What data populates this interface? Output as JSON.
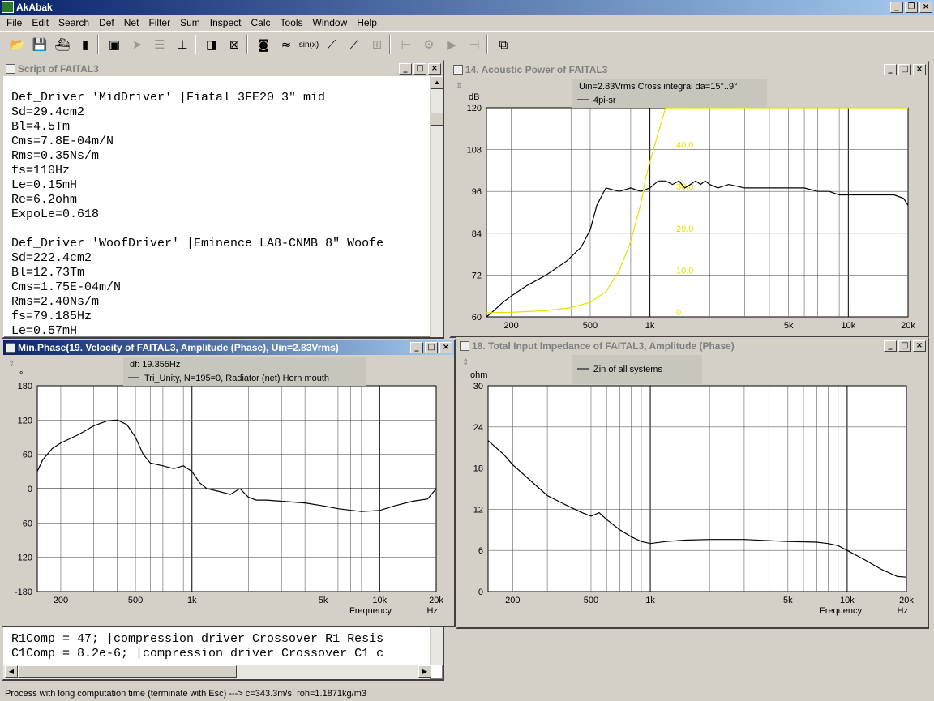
{
  "app": {
    "title": "AkAbak"
  },
  "menu": [
    "File",
    "Edit",
    "Search",
    "Def",
    "Net",
    "Filter",
    "Sum",
    "Inspect",
    "Calc",
    "Tools",
    "Window",
    "Help"
  ],
  "toolbar": {
    "buttons": [
      {
        "name": "open-folder-icon",
        "glyph": "📂"
      },
      {
        "name": "save-disk-icon",
        "glyph": "💾"
      },
      {
        "name": "ship-icon",
        "glyph": "⛴"
      },
      {
        "name": "bar-chart-icon",
        "glyph": "▮"
      },
      {
        "name": "copy-document-icon",
        "glyph": "▣"
      },
      {
        "name": "pointer-icon",
        "glyph": "➤"
      },
      {
        "name": "list-icon",
        "glyph": "☰"
      },
      {
        "name": "graph-axes-icon",
        "glyph": "⊥"
      },
      {
        "name": "speaker-icon",
        "glyph": "◨"
      },
      {
        "name": "speaker-cross-icon",
        "glyph": "⊠"
      },
      {
        "name": "loudspeaker-box-icon",
        "glyph": "◙"
      },
      {
        "name": "filter-icon",
        "glyph": "≈"
      },
      {
        "name": "sin-function-icon",
        "glyph": "sin(x)"
      },
      {
        "name": "curve-cursor-icon",
        "glyph": "⟋"
      },
      {
        "name": "curve-cursor-green-icon",
        "glyph": "⟋"
      },
      {
        "name": "curve-grid-icon",
        "glyph": "⊞"
      },
      {
        "name": "split-icon",
        "glyph": "⊢"
      },
      {
        "name": "gear-icon",
        "glyph": "⚙"
      },
      {
        "name": "play-icon",
        "glyph": "▶"
      },
      {
        "name": "lines-icon",
        "glyph": "⊣"
      },
      {
        "name": "chart-tile-icon",
        "glyph": "⧉"
      }
    ]
  },
  "script_window": {
    "title": "Script of FAITAL3",
    "lines": [
      "Def_Driver 'MidDriver' |Fiatal 3FE20 3\" mid",
      "Sd=29.4cm2",
      "Bl=4.5Tm",
      "Cms=7.8E-04m/N",
      "Rms=0.35Ns/m",
      "fs=110Hz",
      "Le=0.15mH",
      "Re=6.2ohm",
      "ExpoLe=0.618",
      "",
      "Def_Driver 'WoofDriver' |Eminence LA8-CNMB 8\" Woofe",
      "Sd=222.4cm2",
      "Bl=12.73Tm",
      "Cms=1.75E-04m/N",
      "Rms=2.40Ns/m",
      "fs=79.185Hz",
      "Le=0.57mH"
    ],
    "bottom_lines": [
      "R1Comp = 47; |compression driver Crossover R1 Resis",
      "C1Comp = 8.2e-6; |compression driver Crossover C1 c"
    ]
  },
  "chart_data": [
    {
      "window_title": "14. Acoustic Power of FAITAL3",
      "type": "line",
      "legend": {
        "title": "Uin=2.83Vrms Cross integral da=15°..9°",
        "entries": [
          "4pi-sr"
        ]
      },
      "ylabel": "dB",
      "ylim": [
        60,
        120
      ],
      "yticks": [
        60,
        72,
        84,
        96,
        108,
        120
      ],
      "xscale": "log",
      "xlim": [
        150,
        20000
      ],
      "xticks": [
        {
          "v": 200,
          "l": "200"
        },
        {
          "v": 500,
          "l": "500"
        },
        {
          "v": 1000,
          "l": "1k"
        },
        {
          "v": 5000,
          "l": "5k"
        },
        {
          "v": 10000,
          "l": "10k"
        },
        {
          "v": 20000,
          "l": "20k"
        }
      ],
      "right_axis": {
        "labels": [
          {
            "v": 0,
            "l": "0"
          },
          {
            "v": 10,
            "l": "10.0"
          },
          {
            "v": 20,
            "l": "20.0"
          },
          {
            "v": 30,
            "l": "30.0"
          },
          {
            "v": 40,
            "l": "40.0"
          }
        ],
        "ylim": [
          0,
          50
        ],
        "color": "#e8e000"
      },
      "series": [
        {
          "name": "4pi-sr",
          "color": "#000000",
          "axis": "left",
          "x": [
            150,
            165,
            180,
            200,
            240,
            300,
            380,
            450,
            500,
            540,
            600,
            700,
            800,
            900,
            1000,
            1100,
            1200,
            1300,
            1400,
            1500,
            1600,
            1700,
            1800,
            1900,
            2000,
            2200,
            2500,
            3000,
            3500,
            4000,
            5000,
            6000,
            7000,
            8000,
            9000,
            10000,
            12000,
            15000,
            17000,
            19000,
            20000
          ],
          "y": [
            60,
            62,
            64,
            66,
            69,
            72,
            76,
            80,
            85,
            92,
            97,
            96,
            97,
            96,
            97,
            99,
            99,
            98,
            99,
            97,
            98,
            99,
            98,
            99,
            98,
            97,
            98,
            97,
            97,
            97,
            97,
            97,
            96,
            96,
            95,
            95,
            95,
            95,
            95,
            94,
            92
          ]
        },
        {
          "name": "",
          "color": "#e8e000",
          "axis": "right",
          "x": [
            150,
            200,
            300,
            400,
            500,
            600,
            700,
            800,
            900,
            950,
            1000,
            1100,
            1200,
            1500,
            2000,
            5000,
            10000,
            20000
          ],
          "y": [
            1,
            1.1,
            1.5,
            2.2,
            3.5,
            6,
            11,
            18,
            27,
            33,
            37,
            44,
            50,
            50,
            50,
            50,
            50,
            50
          ]
        }
      ],
      "xlabel": ""
    },
    {
      "window_title": "Min.Phase(19. Velocity of FAITAL3, Amplitude (Phase), Uin=2.83Vrms)",
      "type": "line",
      "legend": {
        "title": "df: 19.355Hz",
        "entries": [
          "Tri_Unity, N=195=0, Radiator (net) Horn mouth"
        ]
      },
      "ylabel": "°",
      "ylim": [
        -180,
        180
      ],
      "yticks": [
        -180,
        -120,
        -60,
        0,
        60,
        120,
        180
      ],
      "xscale": "log",
      "xlim": [
        150,
        20000
      ],
      "xticks": [
        {
          "v": 200,
          "l": "200"
        },
        {
          "v": 500,
          "l": "500"
        },
        {
          "v": 1000,
          "l": "1k"
        },
        {
          "v": 5000,
          "l": "5k"
        },
        {
          "v": 10000,
          "l": "10k"
        },
        {
          "v": 20000,
          "l": "20k"
        }
      ],
      "xlabel": "Frequency",
      "xunit": "Hz",
      "series": [
        {
          "name": "Tri_Unity, N=195=0, Radiator (net) Horn mouth",
          "color": "#000000",
          "axis": "left",
          "x": [
            150,
            160,
            180,
            200,
            250,
            300,
            350,
            400,
            450,
            500,
            550,
            600,
            700,
            800,
            900,
            1000,
            1100,
            1200,
            1400,
            1600,
            1800,
            2000,
            2200,
            2500,
            3000,
            4000,
            5000,
            6000,
            8000,
            10000,
            12000,
            15000,
            18000,
            20000
          ],
          "y": [
            30,
            50,
            70,
            80,
            95,
            110,
            118,
            120,
            112,
            90,
            60,
            45,
            40,
            35,
            40,
            30,
            10,
            0,
            -5,
            -10,
            0,
            -15,
            -20,
            -20,
            -22,
            -25,
            -30,
            -35,
            -40,
            -38,
            -30,
            -22,
            -18,
            0
          ]
        }
      ]
    },
    {
      "window_title": "18. Total Input Impedance of FAITAL3, Amplitude (Phase)",
      "type": "line",
      "legend": {
        "title": "",
        "entries": [
          "Zin of all systems"
        ]
      },
      "ylabel": "ohm",
      "ylim": [
        0,
        30
      ],
      "yticks": [
        0,
        6,
        12,
        18,
        24,
        30
      ],
      "xscale": "log",
      "xlim": [
        150,
        20000
      ],
      "xticks": [
        {
          "v": 200,
          "l": "200"
        },
        {
          "v": 500,
          "l": "500"
        },
        {
          "v": 1000,
          "l": "1k"
        },
        {
          "v": 5000,
          "l": "5k"
        },
        {
          "v": 10000,
          "l": "10k"
        },
        {
          "v": 20000,
          "l": "20k"
        }
      ],
      "xlabel": "Frequency",
      "xunit": "Hz",
      "series": [
        {
          "name": "Zin of all systems",
          "color": "#000000",
          "axis": "left",
          "x": [
            150,
            180,
            200,
            250,
            300,
            350,
            400,
            450,
            500,
            550,
            600,
            700,
            800,
            900,
            1000,
            1200,
            1500,
            2000,
            3000,
            5000,
            7000,
            8000,
            9000,
            10000,
            12000,
            15000,
            18000,
            20000
          ],
          "y": [
            22,
            20,
            18.5,
            16,
            14,
            13,
            12.2,
            11.5,
            11,
            11.5,
            10.5,
            9,
            8,
            7.3,
            7,
            7.3,
            7.5,
            7.6,
            7.6,
            7.3,
            7.2,
            7,
            6.7,
            6,
            4.8,
            3.2,
            2.2,
            2.1
          ]
        }
      ]
    }
  ],
  "status": "Process with long computation time (terminate with Esc) ---> c=343.3m/s, roh=1.1871kg/m3"
}
